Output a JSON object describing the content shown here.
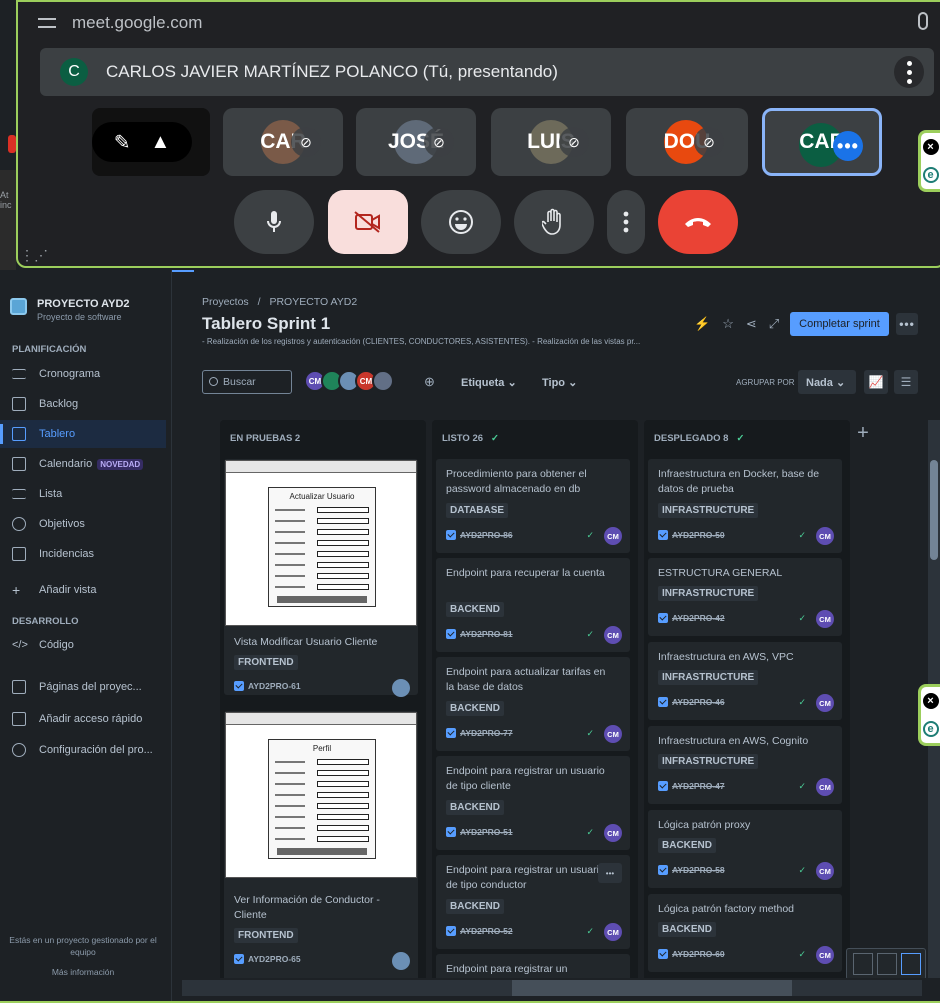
{
  "meet": {
    "url": "meet.google.com",
    "presenter_initial": "C",
    "presenter_name": "CARLOS JAVIER MARTÍNEZ POLANCO (Tú, presentando)",
    "tiles": [
      {
        "label": "CAR",
        "color": "#7a5a48"
      },
      {
        "label": "JOSÉ",
        "color": "#5f6a78"
      },
      {
        "label": "LUIS",
        "color": "#6d6a5a"
      },
      {
        "label": "DOU",
        "color": "#e8490f"
      },
      {
        "label": "CAR",
        "color": "#0b5e42"
      }
    ],
    "more_label": "•••"
  },
  "floating": {
    "x_label": "×",
    "e_label": "e"
  },
  "strip": {
    "text": "At inc"
  },
  "jira": {
    "project_name": "PROYECTO AYD2",
    "project_type": "Proyecto de software",
    "section_planning": "PLANIFICACIÓN",
    "section_dev": "DESARROLLO",
    "nav": {
      "cronograma": "Cronograma",
      "backlog": "Backlog",
      "tablero": "Tablero",
      "calendario": "Calendario",
      "novedad": "NOVEDAD",
      "lista": "Lista",
      "objetivos": "Objetivos",
      "incidencias": "Incidencias",
      "anadir_vista": "Añadir vista",
      "codigo": "Código",
      "paginas": "Páginas del proyec...",
      "acceso": "Añadir acceso rápido",
      "config": "Configuración del pro..."
    },
    "footer_text": "Estás en un proyecto gestionado por el equipo",
    "footer_link": "Más información",
    "breadcrumb_1": "Proyectos",
    "breadcrumb_sep": "/",
    "breadcrumb_2": "PROYECTO AYD2",
    "title": "Tablero Sprint 1",
    "description": "- Realización de los registros y autenticación (CLIENTES, CONDUCTORES, ASISTENTES). - Realización de las vistas pr...",
    "complete_sprint": "Completar sprint",
    "search_placeholder": "Buscar",
    "avatars": [
      {
        "initials": "CM",
        "color": "#5e4db2"
      },
      {
        "initials": "",
        "color": "#1f845a"
      },
      {
        "initials": "",
        "color": "#6b8fb5"
      },
      {
        "initials": "CM",
        "color": "#c9372c"
      },
      {
        "initials": "",
        "color": "#626f86"
      }
    ],
    "filter_label": "Etiqueta ⌄",
    "filter_type": "Tipo ⌄",
    "group_by_label": "AGRUPAR POR",
    "group_by_value": "Nada ⌄",
    "columns": [
      {
        "header": "EN PRUEBAS 2",
        "check": ""
      },
      {
        "header": "LISTO 26",
        "check": "✓"
      },
      {
        "header": "DESPLEGADO 8",
        "check": "✓"
      }
    ],
    "testing_cards": [
      {
        "wire_title": "Actualizar Usuario",
        "title": "Vista Modificar Usuario Cliente",
        "label": "FRONTEND",
        "key": "AYD2PRO-61"
      },
      {
        "wire_title": "Perfil",
        "title": "Ver Información de Conductor - Cliente",
        "label": "FRONTEND",
        "key": "AYD2PRO-65"
      }
    ],
    "ready_cards": [
      {
        "title": "Procedimiento para obtener el password almacenado en db",
        "label": "DATABASE",
        "key": "AYD2PRO-86",
        "assignee": "CM"
      },
      {
        "title": "Endpoint para recuperar la cuenta",
        "label": "BACKEND",
        "key": "AYD2PRO-81",
        "assignee": "CM"
      },
      {
        "title": "Endpoint para actualizar tarifas en la base de datos",
        "label": "BACKEND",
        "key": "AYD2PRO-77",
        "assignee": "CM"
      },
      {
        "title": "Endpoint para registrar un usuario de tipo cliente",
        "label": "BACKEND",
        "key": "AYD2PRO-51",
        "assignee": "CM"
      },
      {
        "title": "Endpoint para registrar un usuario de tipo conductor",
        "label": "BACKEND",
        "key": "AYD2PRO-52",
        "assignee": "CM"
      },
      {
        "title": "Endpoint para registrar un",
        "label": "",
        "key": "",
        "assignee": ""
      }
    ],
    "deployed_cards": [
      {
        "title": "Infraestructura en Docker, base de datos de prueba",
        "label": "INFRASTRUCTURE",
        "key": "AYD2PRO-50",
        "assignee": "CM"
      },
      {
        "title": "ESTRUCTURA GENERAL",
        "label": "INFRASTRUCTURE",
        "key": "AYD2PRO-42",
        "assignee": "CM"
      },
      {
        "title": "Infraestructura en AWS, VPC",
        "label": "INFRASTRUCTURE",
        "key": "AYD2PRO-46",
        "assignee": "CM"
      },
      {
        "title": "Infraestructura en AWS, Cognito",
        "label": "INFRASTRUCTURE",
        "key": "AYD2PRO-47",
        "assignee": "CM"
      },
      {
        "title": "Lógica patrón proxy",
        "label": "BACKEND",
        "key": "AYD2PRO-58",
        "assignee": "CM"
      },
      {
        "title": "Lógica patrón factory method",
        "label": "BACKEND",
        "key": "AYD2PRO-60",
        "assignee": "CM"
      }
    ],
    "done_mark": "✓",
    "card_more": "•••"
  }
}
